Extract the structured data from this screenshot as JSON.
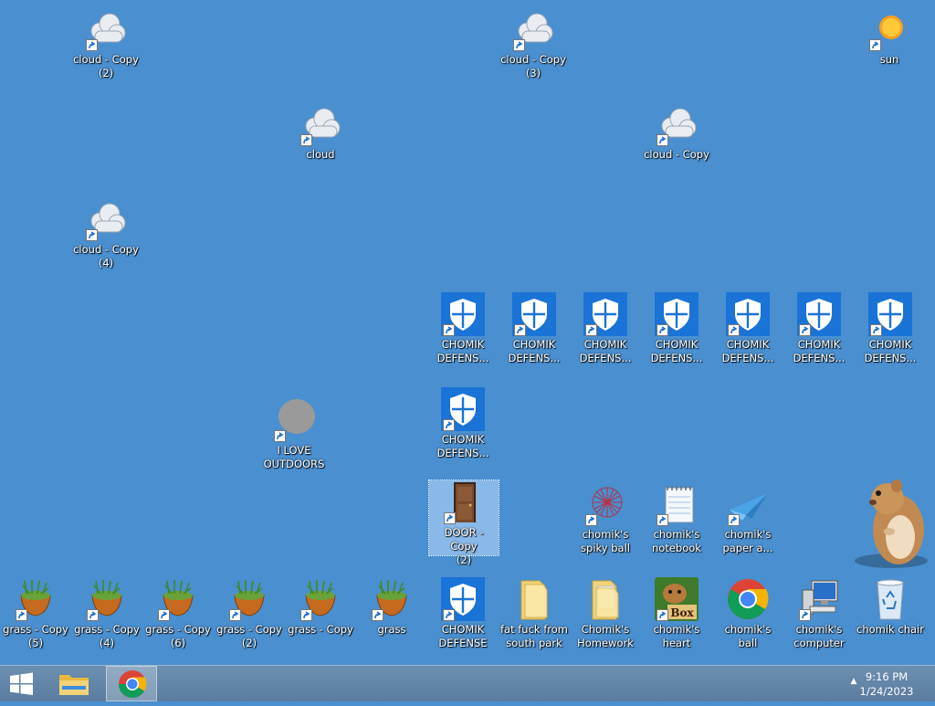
{
  "desktop": {
    "icons": {
      "cloud_copy_2": "cloud - Copy\n(2)",
      "cloud_copy_3": "cloud - Copy\n(3)",
      "sun": "sun",
      "cloud": "cloud",
      "cloud_copy": "cloud - Copy",
      "cloud_copy_4": "cloud - Copy\n(4)",
      "defense_1": "CHOMIK DEFENS...",
      "defense_2": "CHOMIK DEFENS...",
      "defense_3": "CHOMIK DEFENS...",
      "defense_4": "CHOMIK DEFENS...",
      "defense_5": "CHOMIK DEFENS...",
      "defense_6": "CHOMIK DEFENS...",
      "defense_7": "CHOMIK DEFENS...",
      "defense_8": "CHOMIK DEFENS...",
      "i_love_outdoors": "I LOVE OUTDOORS",
      "door_copy_2": "DOOR - Copy\n(2)",
      "spiky_ball": "chomik's spiky ball",
      "notebook": "chomik's notebook",
      "paper_airplane": "chomik's paper a...",
      "grass_copy_5": "grass - Copy\n(5)",
      "grass_copy_4": "grass - Copy\n(4)",
      "grass_copy_6": "grass - Copy\n(6)",
      "grass_copy_2": "grass - Copy\n(2)",
      "grass_copy": "grass - Copy",
      "grass": "grass",
      "chomik_defense": "CHOMIK DEFENSE",
      "south_park": "fat fuck from south park",
      "homework": "Chomik's Homework",
      "heart": "chomik's heart",
      "ball": "chomik's ball",
      "computer": "chomik's computer",
      "chair": "chomik chair"
    }
  },
  "taskbar": {
    "time": "9:16 PM",
    "date": "1/24/2023",
    "tray_arrow": "▲"
  },
  "colors": {
    "desktop_bg": "#4a8fcf",
    "shield_blue": "#1a73d6",
    "taskbar": "#6283a6"
  }
}
